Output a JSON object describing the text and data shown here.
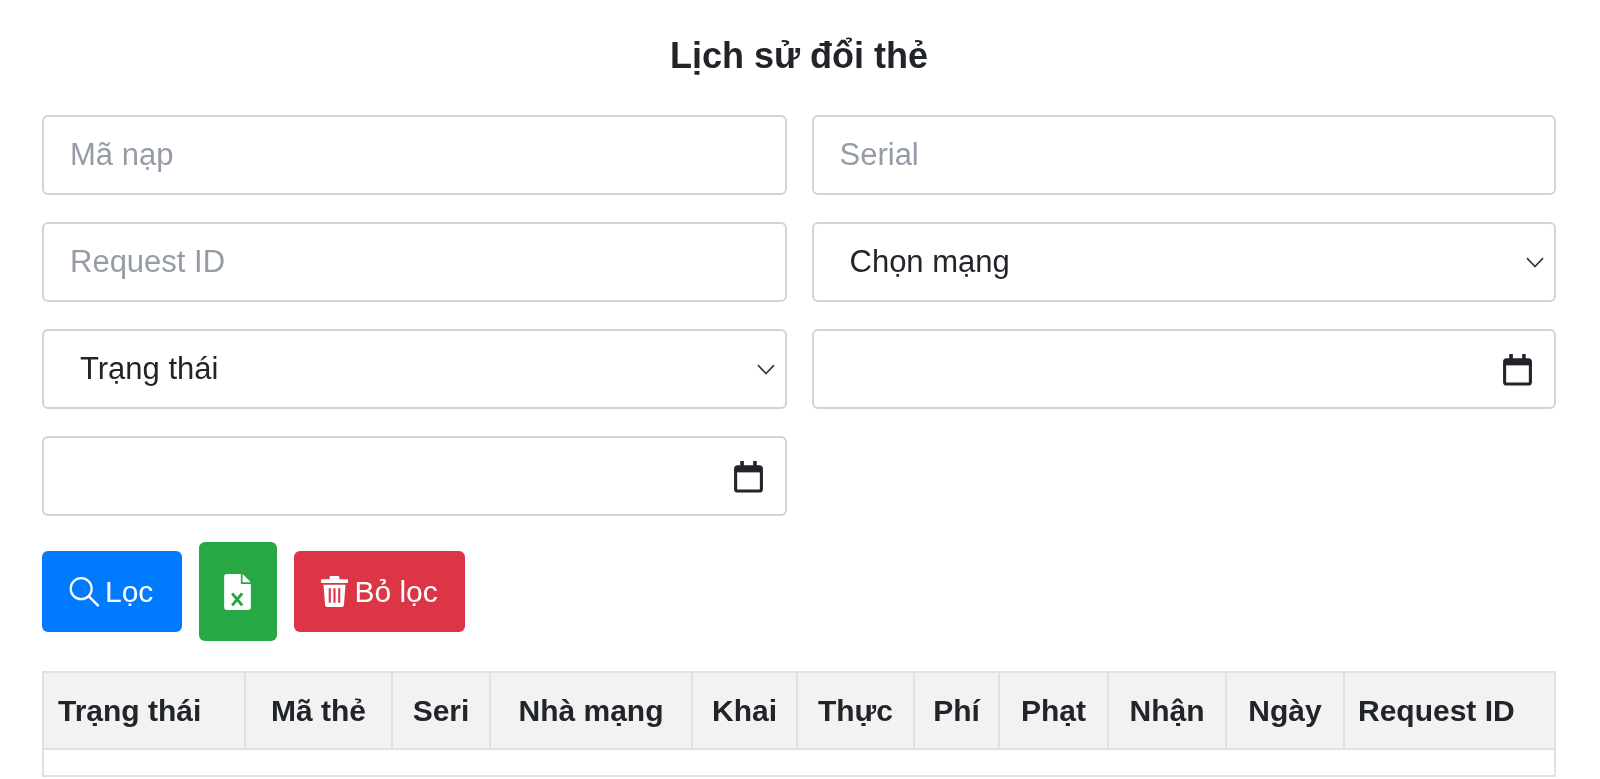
{
  "title": "Lịch sử đổi thẻ",
  "filters": [
    {
      "kind": "text",
      "placeholder": "Mã nạp"
    },
    {
      "kind": "text",
      "placeholder": "Serial"
    },
    {
      "kind": "text",
      "placeholder": "Request ID"
    },
    {
      "kind": "select",
      "value": "Chọn mạng"
    },
    {
      "kind": "select",
      "value": "Trạng thái"
    },
    {
      "kind": "date"
    },
    {
      "kind": "date"
    }
  ],
  "buttons": [
    {
      "kind": "filter",
      "label": "Lọc"
    },
    {
      "kind": "export"
    },
    {
      "kind": "clear",
      "label": "Bỏ lọc"
    }
  ],
  "table": {
    "columns": [
      "Trạng thái",
      "Mã thẻ",
      "Seri",
      "Nhà mạng",
      "Khai",
      "Thực",
      "Phí",
      "Phạt",
      "Nhận",
      "Ngày",
      "Request ID"
    ]
  }
}
